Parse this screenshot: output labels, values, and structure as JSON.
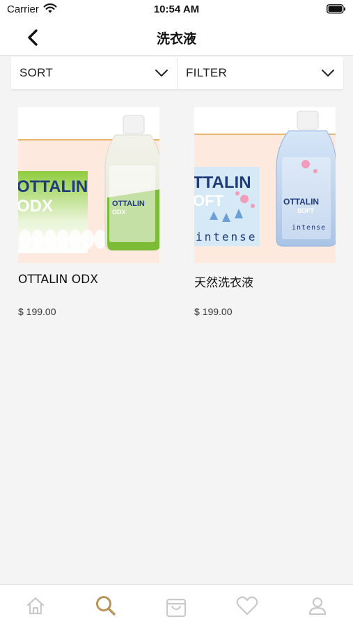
{
  "status_bar": {
    "carrier": "Carrier",
    "time": "10:54 AM"
  },
  "nav": {
    "title": "洗衣液"
  },
  "toolbar": {
    "sort_label": "SORT",
    "filter_label": "FILTER"
  },
  "products": [
    {
      "name": "OTTALIN ODX",
      "price": "$ 199.00",
      "image": {
        "box_text_1": "OTTALIN",
        "box_text_2": "ODX",
        "bottle_text_1": "OTTALIN",
        "bottle_text_2": "ODX",
        "accent_color": "#7cbb35"
      }
    },
    {
      "name": "天然洗衣液",
      "price": "$ 199.00",
      "image": {
        "box_text_1": "TTALIN",
        "box_text_2": "OFT",
        "box_text_3": "intense",
        "bottle_text_1": "OTTALIN",
        "bottle_text_2": "SOFT",
        "bottle_text_3": "intense",
        "accent_color": "#7fa6d6"
      }
    }
  ],
  "tab_bar": {
    "tabs": [
      {
        "icon": "home-icon",
        "active": false
      },
      {
        "icon": "search-icon",
        "active": true
      },
      {
        "icon": "cart-icon",
        "active": false
      },
      {
        "icon": "heart-icon",
        "active": false
      },
      {
        "icon": "profile-icon",
        "active": false
      }
    ],
    "active_color": "#b8935a",
    "inactive_color": "#c9c9c9"
  }
}
